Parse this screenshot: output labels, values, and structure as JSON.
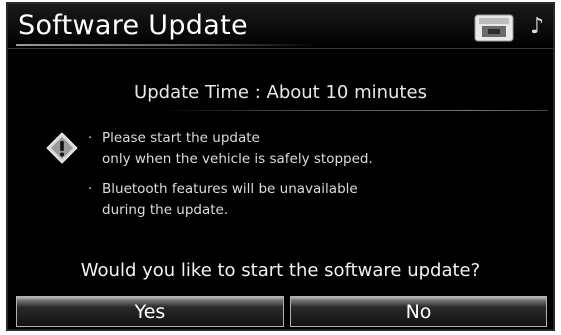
{
  "header": {
    "title": "Software Update",
    "status_icons": [
      "phone-icon",
      "music-note-icon"
    ],
    "note_glyph": "♪"
  },
  "main": {
    "update_time": "Update Time : About 10 minutes",
    "notes": [
      {
        "bullet": "·",
        "lines": [
          "Please start the update",
          "only when the vehicle is safely stopped."
        ]
      },
      {
        "bullet": "·",
        "lines": [
          "Bluetooth features will be unavailable",
          "during the update."
        ]
      }
    ],
    "warning_icon": "warning-icon",
    "question": "Would you like to start the software update?"
  },
  "buttons": {
    "yes_label": "Yes",
    "no_label": "No"
  },
  "colors": {
    "background": "#000000",
    "text": "#ffffff",
    "button_highlight": "#bcbcbc"
  }
}
